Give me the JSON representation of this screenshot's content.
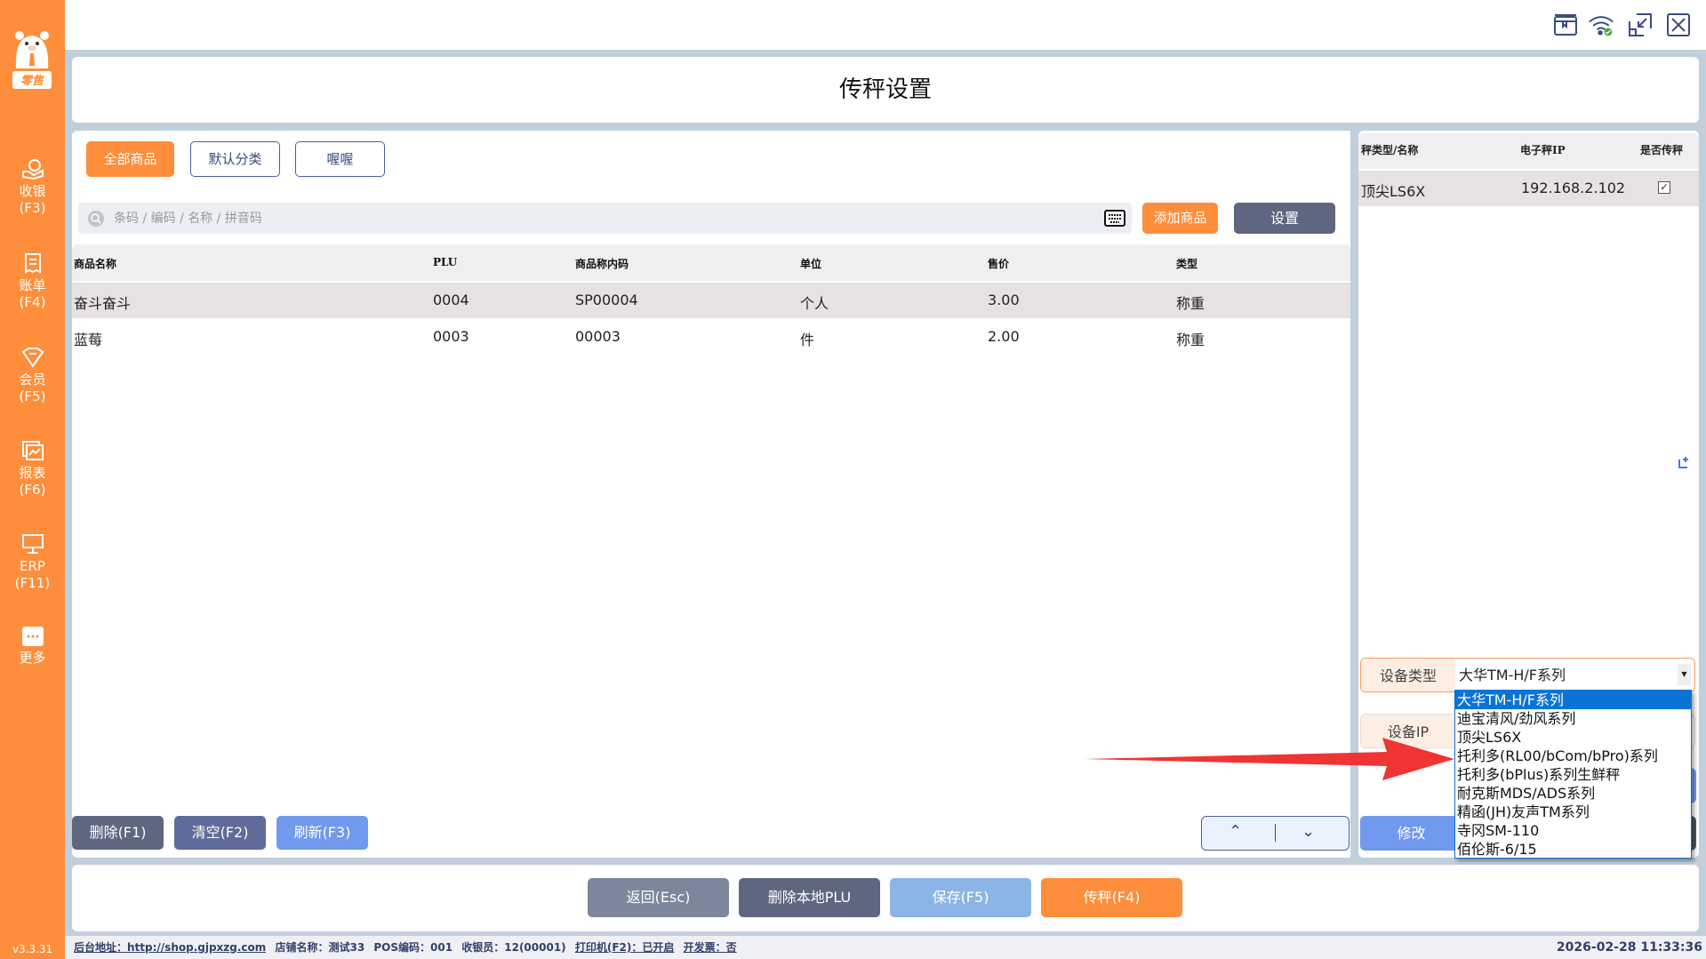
{
  "sidebar": {
    "logo_text": "零售",
    "items": [
      {
        "label": "收银",
        "key": "(F3)"
      },
      {
        "label": "账单",
        "key": "(F4)"
      },
      {
        "label": "会员",
        "key": "(F5)"
      },
      {
        "label": "报表",
        "key": "(F6)"
      },
      {
        "label": "ERP",
        "key": "(F11)"
      },
      {
        "label": "更多",
        "key": ""
      }
    ],
    "version": "v3.3.31"
  },
  "page_title": "传秤设置",
  "filters": [
    "全部商品",
    "默认分类",
    "喔喔"
  ],
  "search": {
    "placeholder": "条码 / 编码 / 名称 / 拼音码"
  },
  "buttons": {
    "add_product": "添加商品",
    "settings": "设置",
    "delete": "删除(F1)",
    "clear": "清空(F2)",
    "refresh": "刷新(F3)",
    "modify": "修改",
    "back": "返回(Esc)",
    "delete_plu": "删除本地PLU",
    "save": "保存(F5)",
    "transfer": "传秤(F4)"
  },
  "table": {
    "headers": [
      "商品名称",
      "PLU",
      "商品称内码",
      "单位",
      "售价",
      "类型"
    ],
    "rows": [
      [
        "奋斗奋斗",
        "0004",
        "SP00004",
        "个人",
        "3.00",
        "称重"
      ],
      [
        "蓝莓",
        "0003",
        "00003",
        "件",
        "2.00",
        "称重"
      ]
    ]
  },
  "scale_table": {
    "headers": [
      "秤类型/名称",
      "电子秤IP",
      "是否传秤"
    ],
    "rows": [
      {
        "name": "顶尖LS6X",
        "ip": "192.168.2.102",
        "checked": true
      }
    ]
  },
  "device": {
    "type_label": "设备类型",
    "type_value": "大华TM-H/F系列",
    "ip_label": "设备IP",
    "options": [
      "大华TM-H/F系列",
      "迪宝清风/劲风系列",
      "顶尖LS6X",
      "托利多(RL00/bCom/bPro)系列",
      "托利多(bPlus)系列生鲜秤",
      "耐克斯MDS/ADS系列",
      "精函(JH)友声TM系列",
      "寺冈SM-110",
      "佰伦斯-6/15"
    ],
    "selected_index": 0
  },
  "status": {
    "backend": "后台地址：http://shop.gjpxzg.com",
    "store": "店铺名称：测试33",
    "pos": "POS编码：001",
    "cashier": "收银员：12(00001)",
    "printer": "打印机(F2)：已开启",
    "invoice": "开发票：否",
    "datetime": "2026-02-28 11:33:36"
  },
  "colors": {
    "accent": "#fe8e3b",
    "dark": "#5f6680",
    "blue": "#7199ee",
    "select": "#0a74d6"
  }
}
